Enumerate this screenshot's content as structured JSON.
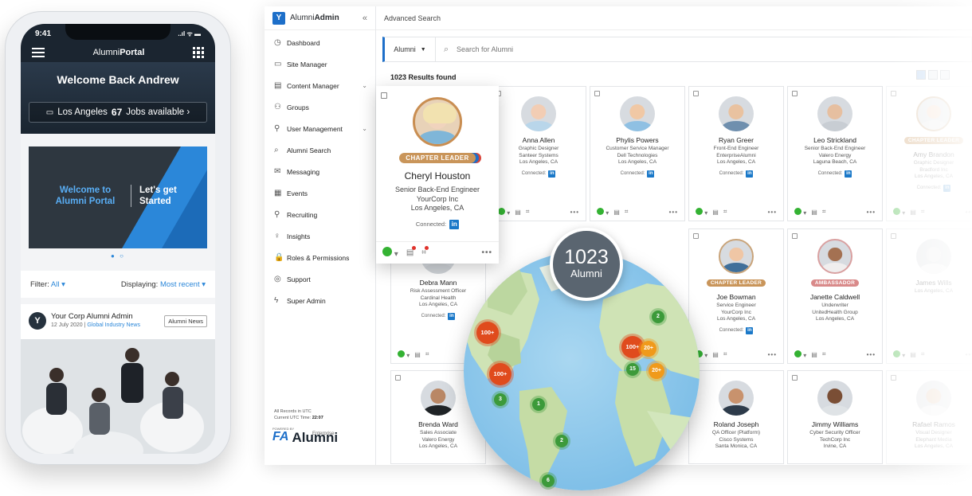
{
  "phone": {
    "status_time": "9:41",
    "status_icons": "..ıl ᯤ ▬",
    "nav_title_1": "Alumni",
    "nav_title_2": "Portal",
    "welcome": "Welcome Back Andrew",
    "jobs_city": "Los Angeles",
    "jobs_count": "67",
    "jobs_label": "Jobs available ›",
    "banner_left": "Welcome to Alumni Portal",
    "banner_right": "Let's get Started",
    "filter_label": "Filter:",
    "filter_value": "All ▾",
    "display_label": "Displaying:",
    "display_value": "Most recent ▾",
    "post_author": "Your Corp Alumni Admin",
    "post_date": "12 July 2020",
    "post_category": "Global Industry News",
    "post_tag": "Alumni News"
  },
  "admin": {
    "brand_1": "Alumni",
    "brand_2": "Admin",
    "collapse": "«",
    "topbar_title": "Advanced Search",
    "search_scope": "Alumni",
    "search_placeholder": "Search for Alumni",
    "results": "1023 Results found",
    "utc_line1": "All Records in UTC",
    "utc_line2": "Current UTC Time:",
    "utc_time": "22:07",
    "powered": "POWERED BY",
    "logo_fa": "FA",
    "logo_alumni": "Alumni",
    "logo_enterprise": "Enterprise",
    "sidebar": [
      {
        "label": "Dashboard",
        "icon": "◷"
      },
      {
        "label": "Site Manager",
        "icon": "▭"
      },
      {
        "label": "Content Manager",
        "icon": "▤",
        "chev": "⌄"
      },
      {
        "label": "Groups",
        "icon": "⚇"
      },
      {
        "label": "User Management",
        "icon": "⚲",
        "chev": "⌄"
      },
      {
        "label": "Alumni Search",
        "icon": "⌕"
      },
      {
        "label": "Messaging",
        "icon": "✉"
      },
      {
        "label": "Events",
        "icon": "▦"
      },
      {
        "label": "Recruiting",
        "icon": "⚲"
      },
      {
        "label": "Insights",
        "icon": "♀"
      },
      {
        "label": "Roles & Permissions",
        "icon": "🔒"
      },
      {
        "label": "Support",
        "icon": "◎"
      },
      {
        "label": "Super Admin",
        "icon": "ϟ"
      }
    ]
  },
  "highlight": {
    "badge": "CHAPTER LEADER",
    "name": "Cheryl Houston",
    "role": "Senior Back-End Engineer",
    "company": "YourCorp Inc",
    "location": "Los Angeles, CA",
    "connected": "Connected:"
  },
  "cards": [
    {
      "name": "Anna Allen",
      "role": "Graphic Designer",
      "company": "Santeer Systems",
      "location": "Los Angeles, CA",
      "connected": "Connected:"
    },
    {
      "name": "Phylis Powers",
      "role": "Customer Service Manager",
      "company": "Dell Technologies",
      "location": "Los Angeles, CA",
      "connected": "Connected:"
    },
    {
      "name": "Ryan Greer",
      "role": "Front-End Engineer",
      "company": "EnterpriseAlumni",
      "location": "Los Angeles, CA",
      "connected": "Connected:"
    },
    {
      "name": "Leo Strickland",
      "role": "Senior Back-End Engineer",
      "company": "Valero Energy",
      "location": "Laguna Beach, CA",
      "connected": "Connected:"
    },
    {
      "name": "Amy Brandon",
      "role": "Graphic Designer",
      "company": "Bradford Inc",
      "location": "Los Angeles, CA",
      "connected": "Connected:",
      "badge": "CHAPTER LEADER"
    },
    {
      "name": "Debra Mann",
      "role": "Risk Assessment Officer",
      "company": "Cardinal Health",
      "location": "Los Angeles, CA",
      "connected": "Connected:"
    },
    {
      "name": "Joe Bowman",
      "role": "Service Engineer",
      "company": "YourCorp Inc",
      "location": "Los Angeles, CA",
      "connected": "Connected:",
      "badge": "CHAPTER LEADER"
    },
    {
      "name": "Janette Caldwell",
      "role": "Underwriter",
      "company": "UnitedHealth Group",
      "location": "Los Angeles, CA",
      "connected": "",
      "badge": "AMBASSADOR"
    },
    {
      "name": "James Wills",
      "role": "Los Angeles, CA",
      "company": "",
      "location": "",
      "connected": ""
    },
    {
      "name": "Brenda Ward",
      "role": "Sales Associate",
      "company": "Valero Energy",
      "location": "Los Angeles, CA",
      "connected": ""
    },
    {
      "name": "Roland Joseph",
      "role": "QA Officer (Platform)",
      "company": "Cisco Systems",
      "location": "Santa Monica, CA",
      "connected": ""
    },
    {
      "name": "Jimmy Williams",
      "role": "Cyber Security Officer",
      "company": "TechCorp Inc",
      "location": "Irvine, CA",
      "connected": ""
    },
    {
      "name": "Rafael Ramos",
      "role": "Visual Designer",
      "company": "Elephant Media",
      "location": "Los Angeles, CA",
      "connected": ""
    }
  ],
  "map": {
    "total": "1023",
    "total_label": "Alumni",
    "clusters": [
      {
        "label": "100+",
        "kind": "red"
      },
      {
        "label": "100+",
        "kind": "red"
      },
      {
        "label": "100+",
        "kind": "red"
      },
      {
        "label": "20+",
        "kind": "org"
      },
      {
        "label": "20+",
        "kind": "org"
      },
      {
        "label": "2",
        "kind": "grn"
      },
      {
        "label": "15",
        "kind": "grn"
      },
      {
        "label": "3",
        "kind": "grn"
      },
      {
        "label": "1",
        "kind": "grn"
      },
      {
        "label": "2",
        "kind": "grn"
      },
      {
        "label": "6",
        "kind": "grn"
      }
    ]
  },
  "colors": {
    "accent": "#1d6fc9",
    "chapter_leader": "#c9955a",
    "ambassador": "#d98a8a",
    "online": "#34b233"
  }
}
